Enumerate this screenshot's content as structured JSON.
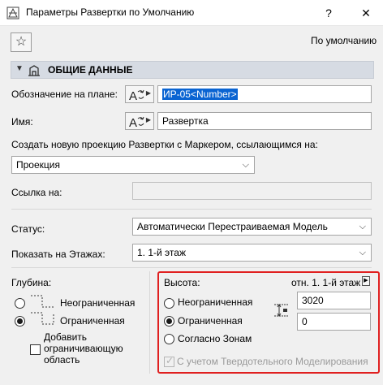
{
  "window": {
    "title": "Параметры Развертки по Умолчанию",
    "help": "?",
    "close": "✕"
  },
  "toolbar": {
    "favorites_icon": "star-icon",
    "default_label": "По умолчанию"
  },
  "section": {
    "title": "ОБЩИЕ ДАННЫЕ",
    "icon": "elevation-icon"
  },
  "general": {
    "plan_label": "Обозначение на плане:",
    "plan_value": "ИР-05<Number>",
    "name_label": "Имя:",
    "name_value": "Развертка",
    "create_label": "Создать новую проекцию Развертки с Маркером, ссылающимся на:",
    "create_value": "Проекция",
    "link_label": "Ссылка на:",
    "link_value": "",
    "status_label": "Статус:",
    "status_value": "Автоматически Перестраиваемая Модель",
    "floors_label": "Показать на Этажах:",
    "floors_value": "1. 1-й этаж"
  },
  "depth": {
    "label": "Глубина:",
    "option_unlimited": "Неограниченная",
    "option_limited": "Ограниченная",
    "selected": "limited",
    "add_boundary": "Добавить\nограничивающую\nобласть",
    "add_boundary_lines": [
      "Добавить",
      "ограничивающую",
      "область"
    ],
    "add_boundary_checked": false
  },
  "height": {
    "label": "Высота:",
    "reference": "отн. 1. 1-й этаж",
    "option_unlimited": "Неограниченная",
    "option_limited": "Ограниченная",
    "option_zones": "Согласно Зонам",
    "selected": "limited",
    "top_value": "3020",
    "bottom_value": "0",
    "solid_ops_label": "С учетом Твердотельного Моделирования",
    "solid_ops_checked": true,
    "solid_ops_enabled": false
  },
  "colors": {
    "highlight": "#e02020",
    "selection": "#0a64d2",
    "section_header": "#d6dbe3"
  }
}
